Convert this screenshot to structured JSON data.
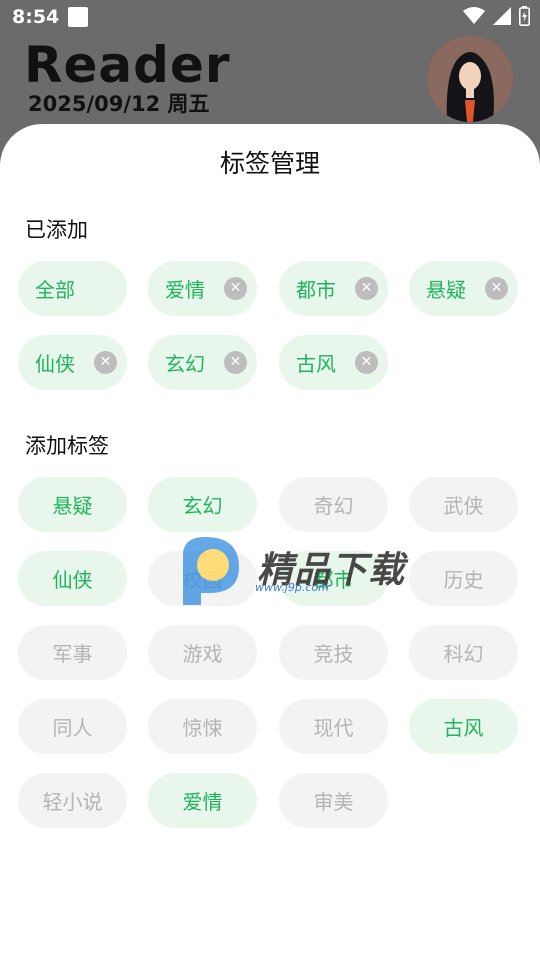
{
  "status_bar": {
    "time": "8:54"
  },
  "header": {
    "title": "Reader",
    "date": "2025/09/12 周五"
  },
  "sheet": {
    "title": "标签管理",
    "added_label": "已添加",
    "add_label": "添加标签",
    "added_tags": [
      {
        "label": "全部",
        "removable": false
      },
      {
        "label": "爱情",
        "removable": true
      },
      {
        "label": "都市",
        "removable": true
      },
      {
        "label": "悬疑",
        "removable": true
      },
      {
        "label": "仙侠",
        "removable": true
      },
      {
        "label": "玄幻",
        "removable": true
      },
      {
        "label": "古风",
        "removable": true
      }
    ],
    "available_tags": [
      {
        "label": "悬疑",
        "selected": true
      },
      {
        "label": "玄幻",
        "selected": true
      },
      {
        "label": "奇幻",
        "selected": false
      },
      {
        "label": "武侠",
        "selected": false
      },
      {
        "label": "仙侠",
        "selected": true
      },
      {
        "label": "校园",
        "selected": false
      },
      {
        "label": "都市",
        "selected": true
      },
      {
        "label": "历史",
        "selected": false
      },
      {
        "label": "军事",
        "selected": false
      },
      {
        "label": "游戏",
        "selected": false
      },
      {
        "label": "竞技",
        "selected": false
      },
      {
        "label": "科幻",
        "selected": false
      },
      {
        "label": "同人",
        "selected": false
      },
      {
        "label": "惊悚",
        "selected": false
      },
      {
        "label": "现代",
        "selected": false
      },
      {
        "label": "古风",
        "selected": true
      },
      {
        "label": "轻小说",
        "selected": false
      },
      {
        "label": "爱情",
        "selected": true
      },
      {
        "label": "审美",
        "selected": false
      }
    ]
  },
  "watermark": {
    "text": "精品下载",
    "url": "www.j9p.com"
  },
  "colors": {
    "accent": "#1fb55e",
    "chip_selected_bg": "#e9f6ec",
    "chip_unselected_bg": "#f3f3f3",
    "chip_unselected_text": "#b4b4b4"
  }
}
